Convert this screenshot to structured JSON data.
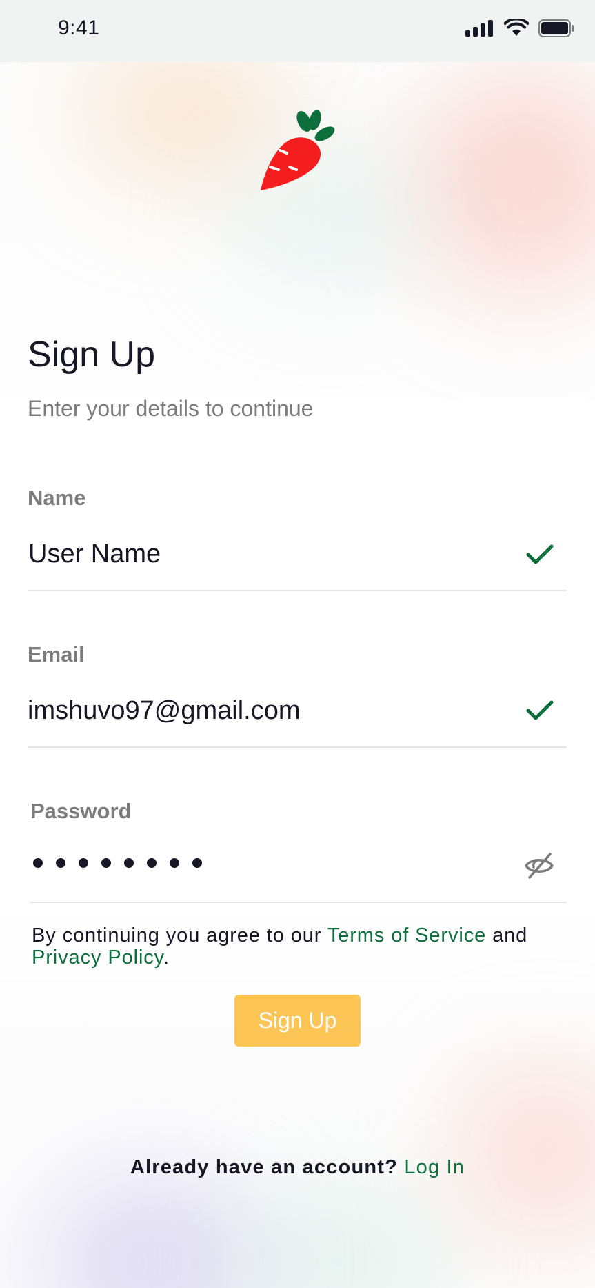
{
  "status_bar": {
    "time": "9:41",
    "icons": [
      "cellular-signal-icon",
      "wifi-icon",
      "battery-icon"
    ]
  },
  "logo": {
    "icon": "carrot-icon",
    "colors": {
      "body": "#f51e1e",
      "leaves": "#0d6f3c"
    }
  },
  "header": {
    "title": "Sign Up",
    "subtitle": "Enter your details to continue"
  },
  "form": {
    "name": {
      "label": "Name",
      "value": "User Name",
      "status_icon": "check-icon"
    },
    "email": {
      "label": "Email",
      "value": "imshuvo97@gmail.com",
      "status_icon": "check-icon"
    },
    "password": {
      "label": "Password",
      "masked_length": 8,
      "toggle_icon": "eye-off-icon"
    }
  },
  "terms": {
    "prefix": "By continuing you agree to our ",
    "terms_link": "Terms of Service",
    "middle": " and",
    "privacy_link": "Privacy Policy",
    "suffix": "."
  },
  "actions": {
    "signup_label": "Sign Up"
  },
  "footer": {
    "prompt": "Already have an account? ",
    "login_link": "Log In"
  },
  "colors": {
    "accent": "#fdc556",
    "link": "#0d6f3c",
    "check": "#0d6f3c",
    "text": "#181725",
    "muted": "#7c7c7c"
  }
}
